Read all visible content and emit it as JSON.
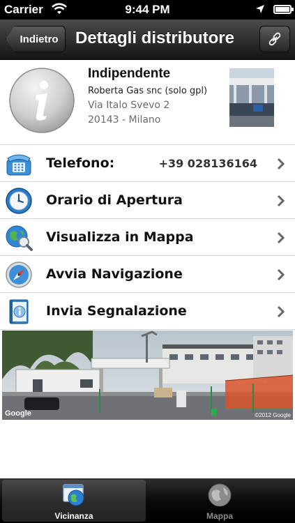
{
  "status_bar": {
    "carrier": "Carrier",
    "time": "9:44 PM"
  },
  "nav": {
    "back_label": "Indietro",
    "title": "Dettagli distributore"
  },
  "station": {
    "brand": "Indipendente",
    "company": "Roberta Gas snc (solo gpl)",
    "address": "Via Italo Svevo 2",
    "city": "20143 - Milano"
  },
  "rows": [
    {
      "label": "Telefono:",
      "value": "+39 028136164",
      "icon": "phone-icon"
    },
    {
      "label": "Orario di Apertura",
      "icon": "clock-icon"
    },
    {
      "label": "Visualizza in Mappa",
      "icon": "map-search-icon"
    },
    {
      "label": "Avvia Navigazione",
      "icon": "compass-icon"
    },
    {
      "label": "Invia Segnalazione",
      "icon": "report-book-icon"
    }
  ],
  "street_view": {
    "logo": "Google",
    "copyright": "©2012 Google"
  },
  "tabs": [
    {
      "label": "Vicinanza",
      "icon": "nearby-globe-icon",
      "active": true
    },
    {
      "label": "Mappa",
      "icon": "globe-icon",
      "active": false
    }
  ],
  "colors": {
    "nav_bar": "#2a2a2a",
    "tab_bar": "#111111",
    "separator": "#d6d6d6"
  }
}
